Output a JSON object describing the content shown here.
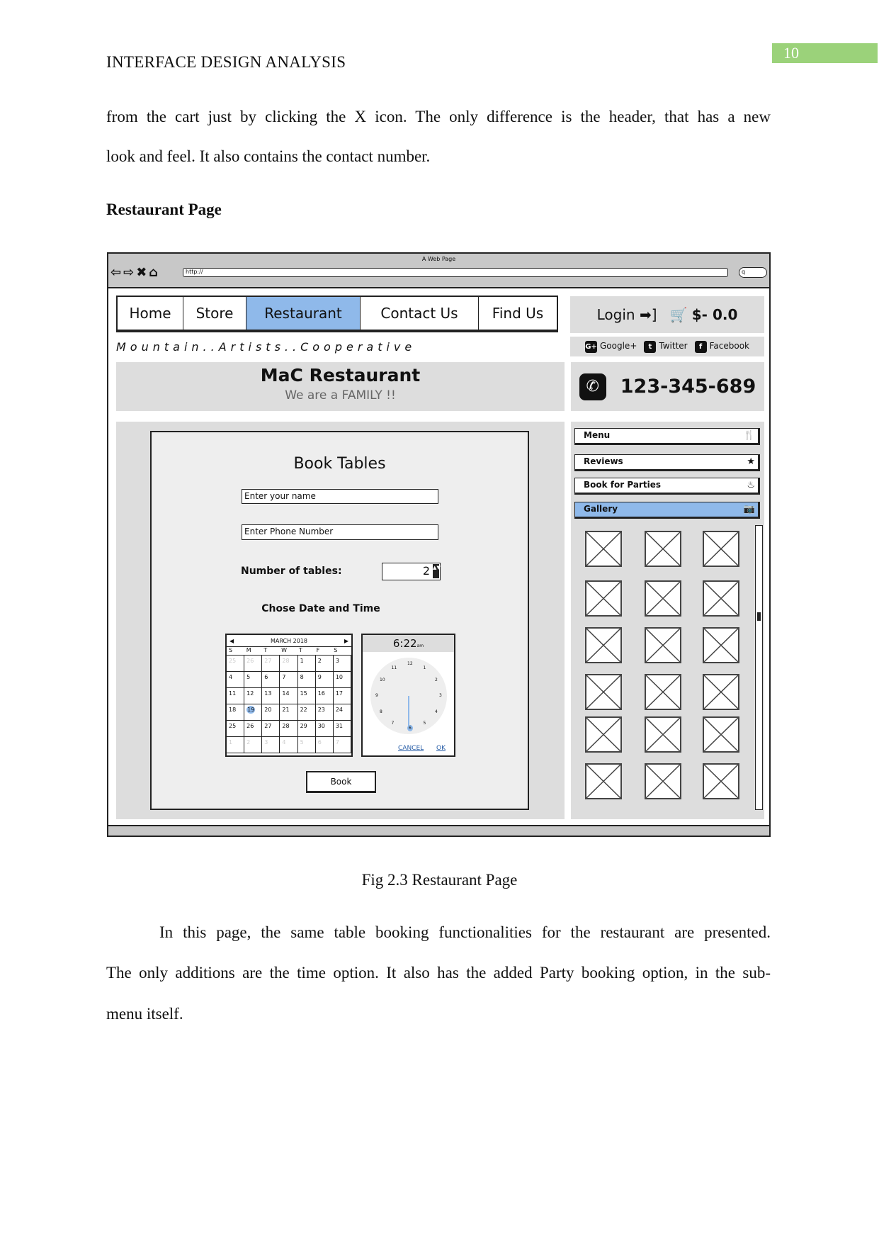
{
  "page_number": "10",
  "running_head": "INTERFACE DESIGN ANALYSIS",
  "intro_lines": [
    "from the cart just by clicking the X icon. The only difference is the header, that has a new",
    "look and feel. It also contains the contact number."
  ],
  "section_heading": "Restaurant Page",
  "wireframe": {
    "window_title": "A Web Page",
    "url": "http://",
    "nav_tabs": [
      {
        "label": "Home"
      },
      {
        "label": "Store"
      },
      {
        "label": "Restaurant",
        "active": true
      },
      {
        "label": "Contact Us"
      },
      {
        "label": "Find Us"
      }
    ],
    "login_label": "Login",
    "cart_total": "$- 0.0",
    "social": [
      "Google+",
      "Twitter",
      "Facebook"
    ],
    "tagline": "Mountain..Artists..Cooperative",
    "restaurant_name": "MaC Restaurant",
    "restaurant_slogan": "We are a FAMILY !!",
    "phone": "123-345-689",
    "booking": {
      "title": "Book Tables",
      "name_placeholder": "Enter your name",
      "phone_placeholder": "Enter Phone Number",
      "tables_label": "Number of tables:",
      "tables_value": "2",
      "datetime_label": "Chose Date and Time",
      "calendar": {
        "month": "MARCH 2018",
        "weekdays": [
          "S",
          "M",
          "T",
          "W",
          "T",
          "F",
          "S"
        ],
        "weeks": [
          [
            "25",
            "26",
            "27",
            "28",
            "1",
            "2",
            "3"
          ],
          [
            "4",
            "5",
            "6",
            "7",
            "8",
            "9",
            "10"
          ],
          [
            "11",
            "12",
            "13",
            "14",
            "15",
            "16",
            "17"
          ],
          [
            "18",
            "19",
            "20",
            "21",
            "22",
            "23",
            "24"
          ],
          [
            "25",
            "26",
            "27",
            "28",
            "29",
            "30",
            "31"
          ],
          [
            "1",
            "2",
            "3",
            "4",
            "5",
            "6",
            "7"
          ]
        ],
        "selected": "19"
      },
      "time": "6:22",
      "time_suffix": "am",
      "clock_hours": [
        "12",
        "1",
        "2",
        "3",
        "4",
        "5",
        "6",
        "7",
        "8",
        "9",
        "10",
        "11"
      ],
      "cancel_label": "CANCEL",
      "ok_label": "OK",
      "book_label": "Book"
    },
    "side_menu": [
      {
        "label": "Menu",
        "icon": "fork-knife-icon"
      },
      {
        "label": "Reviews",
        "icon": "star-icon"
      },
      {
        "label": "Book for Parties",
        "icon": "cake-icon"
      },
      {
        "label": "Gallery",
        "icon": "camera-icon",
        "active": true
      }
    ],
    "gallery_count": 18,
    "accent_color": "#8fb9ea"
  },
  "caption": "Fig 2.3 Restaurant Page",
  "outro_lines": [
    "In this page, the same table booking functionalities for the restaurant are presented.",
    "The only additions are the time option. It also has the added Party booking option, in the sub-",
    "menu itself."
  ]
}
